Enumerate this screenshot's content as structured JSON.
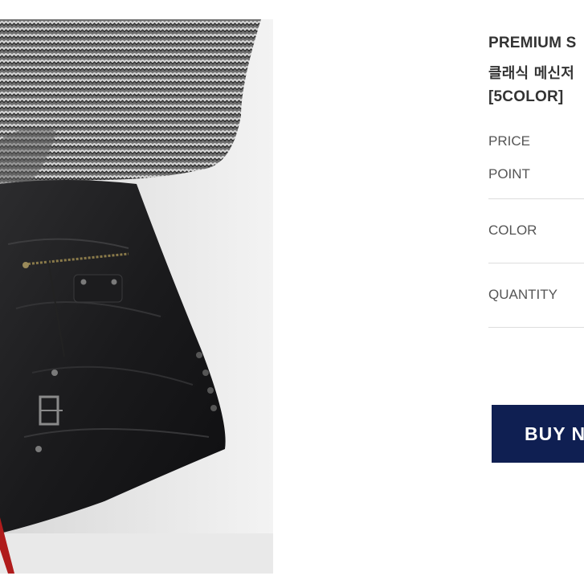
{
  "product": {
    "image_icon": "leather-bag-photo",
    "title_line1": "PREMIUM S",
    "title_line2": "클래식 메신저",
    "title_line3": "[5COLOR]"
  },
  "options": {
    "price_label": "PRICE",
    "point_label": "POINT",
    "color_label": "COLOR",
    "quantity_label": "QUANTITY"
  },
  "actions": {
    "buy_label": "BUY N"
  },
  "colors": {
    "buy_button_bg": "#0f1f52",
    "divider": "#dddddd",
    "title_text": "#333333",
    "label_text": "#555555"
  }
}
